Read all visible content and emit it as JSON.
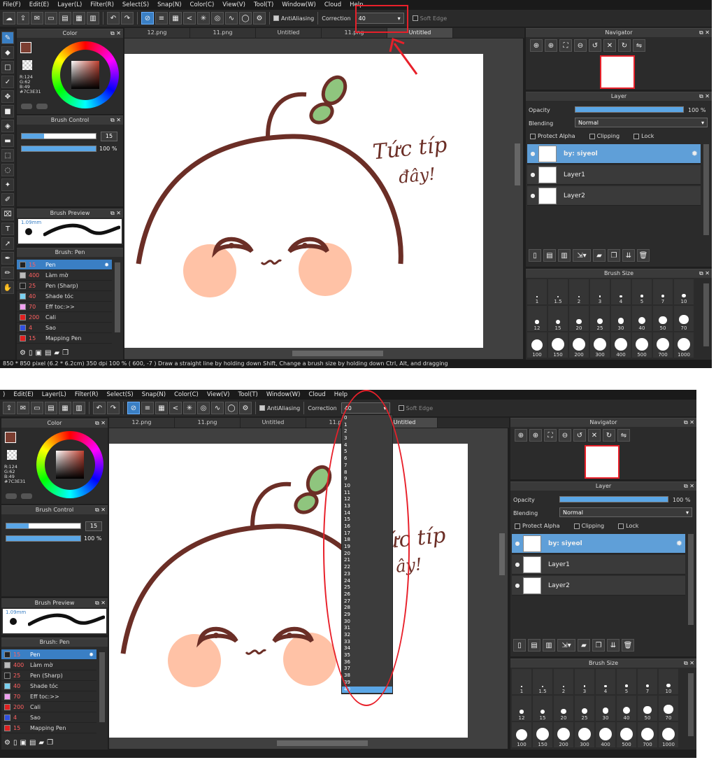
{
  "menu": [
    "File(F)",
    "Edit(E)",
    "Layer(L)",
    "Filter(R)",
    "Select(S)",
    "Snap(N)",
    "Color(C)",
    "View(V)",
    "Tool(T)",
    "Window(W)",
    "Cloud",
    "Help"
  ],
  "menu2": [
    ")",
    "Edit(E)",
    "Layer(L)",
    "Filter(R)",
    "Select(S)",
    "Snap(N)",
    "Color(C)",
    "View(V)",
    "Tool(T)",
    "Window(W)",
    "Cloud",
    "Help"
  ],
  "toolbar": {
    "antialias": "AntiAliasing",
    "correction_label": "Correction",
    "correction_value": "40",
    "soft_edge": "Soft Edge"
  },
  "color": {
    "title": "Color",
    "r": "R:124",
    "g": "G:62",
    "b": "B:49",
    "hex": "#7C3E31",
    "fg": "#7c3e31",
    "bg": "#f3e9c3"
  },
  "brush_control": {
    "title": "Brush Control",
    "size": "15",
    "opacity": "100 %"
  },
  "brush_preview": {
    "title": "Brush Preview",
    "size_label": "1.09mm"
  },
  "brush_list": {
    "title": "Brush: Pen",
    "items": [
      {
        "size": "15",
        "name": "Pen",
        "color": "#222222"
      },
      {
        "size": "400",
        "name": "Làm mờ",
        "color": "#bbbbbb"
      },
      {
        "size": "25",
        "name": "Pen (Sharp)",
        "color": "#222222"
      },
      {
        "size": "40",
        "name": "Shade tóc",
        "color": "#7ad0f0"
      },
      {
        "size": "70",
        "name": "Eff toc:>>",
        "color": "#f0a0f0"
      },
      {
        "size": "200",
        "name": "Cali",
        "color": "#e02020"
      },
      {
        "size": "4",
        "name": "Sao",
        "color": "#3050e0"
      },
      {
        "size": "15",
        "name": "Mapping Pen",
        "color": "#e02020"
      }
    ]
  },
  "tabs": [
    "12.png",
    "11.png",
    "Untitled",
    "11.png",
    "Untitled"
  ],
  "navigator": {
    "title": "Navigator"
  },
  "layer": {
    "title": "Layer",
    "opacity_label": "Opacity",
    "opacity_value": "100 %",
    "blending_label": "Blending",
    "blending_value": "Normal",
    "protect_alpha": "Protect Alpha",
    "clipping": "Clipping",
    "lock": "Lock",
    "rows": [
      "by: siyeol",
      "Layer1",
      "Layer2"
    ]
  },
  "brush_size": {
    "title": "Brush Size",
    "sizes": [
      "1",
      "1.5",
      "2",
      "3",
      "4",
      "5",
      "7",
      "10",
      "12",
      "15",
      "20",
      "25",
      "30",
      "40",
      "50",
      "70",
      "100",
      "150",
      "200",
      "300",
      "400",
      "500",
      "700",
      "1000"
    ]
  },
  "status": "850 * 850 pixel   (6.2 * 6.2cm)   350 dpi   100 %   ( 600, -7 )   Draw a straight line by holding down Shift, Change a brush size by holding down Ctrl, Alt, and dragging",
  "drawing_text": {
    "line1": "Tức típ",
    "line2": "đây!",
    "line1_partial": "ức típ",
    "line2_partial": "ây!"
  },
  "dropdown_options": [
    "0",
    "1",
    "2",
    "3",
    "4",
    "5",
    "6",
    "7",
    "8",
    "9",
    "10",
    "11",
    "12",
    "13",
    "14",
    "15",
    "16",
    "17",
    "18",
    "19",
    "20",
    "21",
    "22",
    "23",
    "24",
    "25",
    "26",
    "27",
    "28",
    "29",
    "30",
    "31",
    "32",
    "33",
    "34",
    "35",
    "36",
    "37",
    "38",
    "39",
    "40"
  ],
  "colors": {
    "annotation": "#e8202a",
    "accent": "#3a7fc4",
    "stroke": "#6b2e26",
    "cheek": "#ffc2a6",
    "leaf": "#8fc57e"
  }
}
